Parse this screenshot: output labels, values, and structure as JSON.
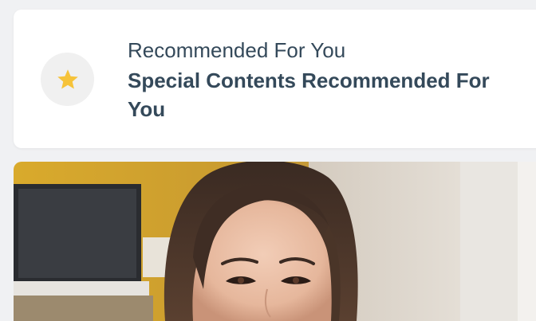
{
  "recommended": {
    "subtitle": "Recommended For You",
    "title": "Special Contents Recommended For You",
    "icon": "star-icon",
    "icon_color": "#f6c33a",
    "badge_color": "#f0f0f0"
  },
  "feature_card": {
    "image": "woman-portrait-photo"
  }
}
